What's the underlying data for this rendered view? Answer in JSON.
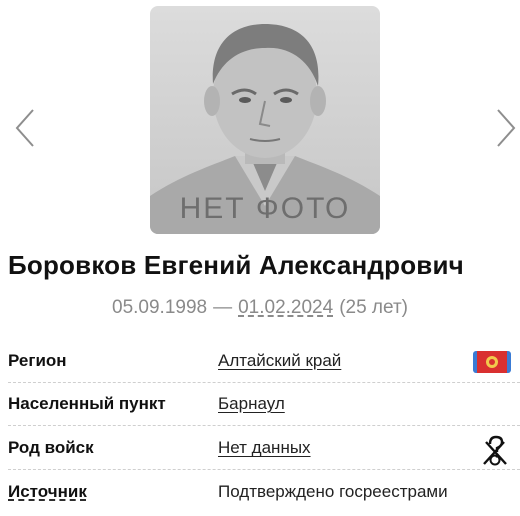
{
  "photo": {
    "placeholder_text": "НЕТ ФОТО",
    "flag_icon": "flag-icon",
    "flag_color": "#e25a5a"
  },
  "nav": {
    "prev_icon": "chevron-left-icon",
    "next_icon": "chevron-right-icon"
  },
  "person": {
    "full_name": "Боровков Евгений Александрович",
    "birth_date": "05.09.1998",
    "dash": "—",
    "death_date": "01.02.2024",
    "age": "(25 лет)"
  },
  "details": {
    "region": {
      "label": "Регион",
      "value": "Алтайский край",
      "icon": "region-flag-icon"
    },
    "locality": {
      "label": "Населенный пункт",
      "value": "Барнаул"
    },
    "branch": {
      "label": "Род войск",
      "value": "Нет данных",
      "icon": "unknown-branch-icon"
    },
    "source": {
      "label": "Источник",
      "value": "Подтверждено госреестрами"
    }
  }
}
